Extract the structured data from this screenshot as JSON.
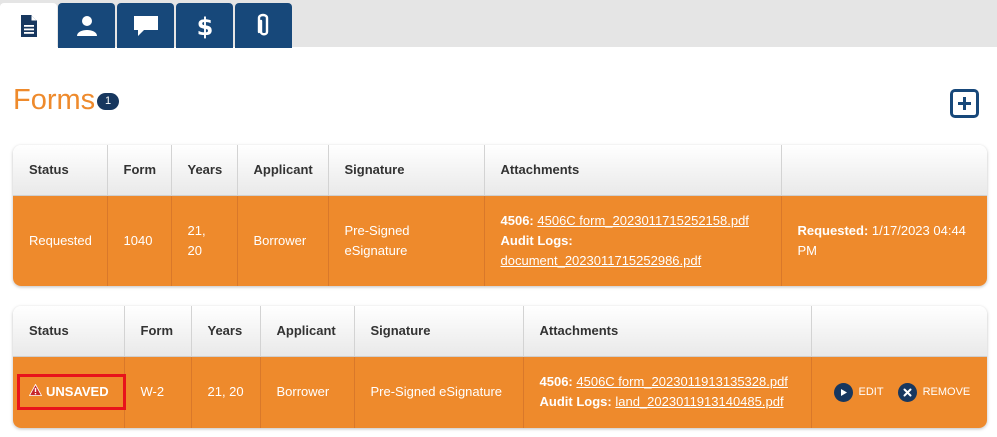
{
  "tabs": [
    {
      "name": "document",
      "icon": "document-icon",
      "active": true
    },
    {
      "name": "person",
      "icon": "person-icon",
      "active": false
    },
    {
      "name": "comments",
      "icon": "chat-icon",
      "active": false
    },
    {
      "name": "fees",
      "icon": "dollar-icon",
      "active": false
    },
    {
      "name": "attachments",
      "icon": "paperclip-icon",
      "active": false
    }
  ],
  "header": {
    "title": "Forms",
    "count": "1",
    "add_icon": "plus-square-icon"
  },
  "colors": {
    "accent": "#ee8a2c",
    "navy": "#17487a",
    "badge": "#17375f",
    "highlight": "#e8131b"
  },
  "table1": {
    "columns": [
      "Status",
      "Form",
      "Years",
      "Applicant",
      "Signature",
      "Attachments",
      ""
    ],
    "row": {
      "status": "Requested",
      "form": "1040",
      "years_line1": "21,",
      "years_line2": "20",
      "applicant": "Borrower",
      "signature_line1": "Pre-Signed",
      "signature_line2": "eSignature",
      "att1_label": "4506:",
      "att1_link": "4506C form_2023011715252158.pdf",
      "att2_label": "Audit Logs:",
      "att2_link": "document_2023011715252986.pdf",
      "requested_label": "Requested:",
      "requested_value": "1/17/2023 04:44 PM"
    }
  },
  "table2": {
    "columns": [
      "Status",
      "Form",
      "Years",
      "Applicant",
      "Signature",
      "Attachments",
      ""
    ],
    "row": {
      "status": "UNSAVED",
      "status_icon": "warning-icon",
      "form": "W-2",
      "years": "21, 20",
      "applicant": "Borrower",
      "signature": "Pre-Signed eSignature",
      "att1_label": "4506:",
      "att1_link": "4506C form_2023011913135328.pdf",
      "att2_label": "Audit Logs:",
      "att2_link": "land_2023011913140485.pdf",
      "edit_label": "EDIT",
      "edit_icon": "play-circle-icon",
      "remove_label": "REMOVE",
      "remove_icon": "close-circle-icon"
    }
  }
}
